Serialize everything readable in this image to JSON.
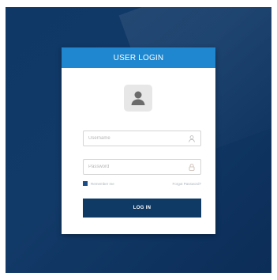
{
  "login": {
    "header_title": "USER LOGIN",
    "username_placeholder": "Username",
    "password_placeholder": "Password",
    "remember_label": "Remember me",
    "forgot_link": "Forgot Password?",
    "login_button": "LOG IN"
  },
  "colors": {
    "background": "#123a68",
    "header": "#1f87cf",
    "button": "#0f3a66",
    "checkbox": "#1b4e86"
  },
  "icons": {
    "avatar": "user-avatar-icon",
    "username": "user-icon",
    "password": "lock-icon"
  }
}
